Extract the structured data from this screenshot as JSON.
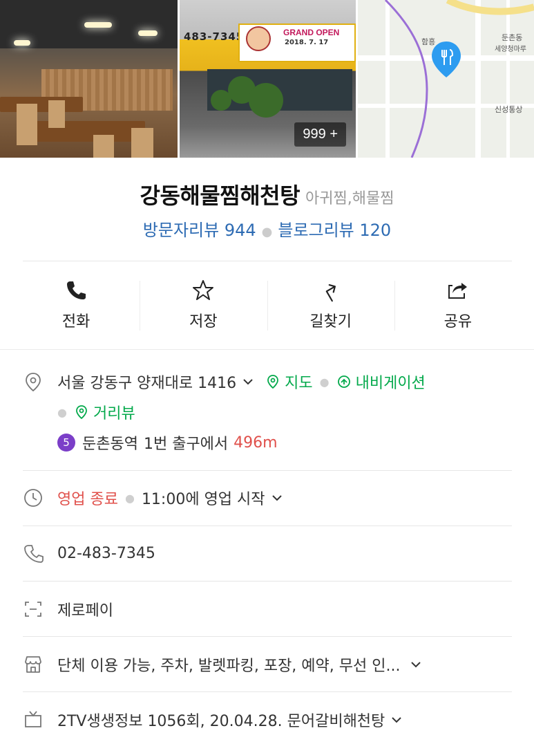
{
  "photos": {
    "count_label": "999 +",
    "storefront_phone": "483-7345",
    "banner_title": "GRAND OPEN",
    "banner_date": "2018. 7. 17",
    "map_labels": [
      "둔촌동",
      "세양청마루",
      "신성통상",
      "함흥"
    ]
  },
  "place": {
    "name": "강동해물찜해천탕",
    "category": "아귀찜,해물찜",
    "visitor_review": "방문자리뷰 944",
    "blog_review": "블로그리뷰 120"
  },
  "actions": [
    {
      "label": "전화",
      "icon": "phone-icon"
    },
    {
      "label": "저장",
      "icon": "star-icon"
    },
    {
      "label": "길찾기",
      "icon": "directions-icon"
    },
    {
      "label": "공유",
      "icon": "share-icon"
    }
  ],
  "info": {
    "address": "서울 강동구 양재대로 1416",
    "map_link": "지도",
    "nav_link": "내비게이션",
    "street_link": "거리뷰",
    "subway_line": "5",
    "subway_station": "둔촌동역",
    "subway_exit": "1번 출구에서",
    "subway_distance": "496m",
    "status": "영업 종료",
    "hours": "11:00에 영업 시작",
    "phone": "02-483-7345",
    "payment": "제로페이",
    "amenities": "단체 이용 가능, 주차, 발렛파킹, 포장, 예약, 무선 인...",
    "tv": "2TV생생정보 1056회, 20.04.28. 문어갈비해천탕"
  },
  "colors": {
    "link_blue": "#2d6bb3",
    "green": "#03a94b",
    "red": "#e0504b",
    "subway_purple": "#7b3ec8"
  }
}
